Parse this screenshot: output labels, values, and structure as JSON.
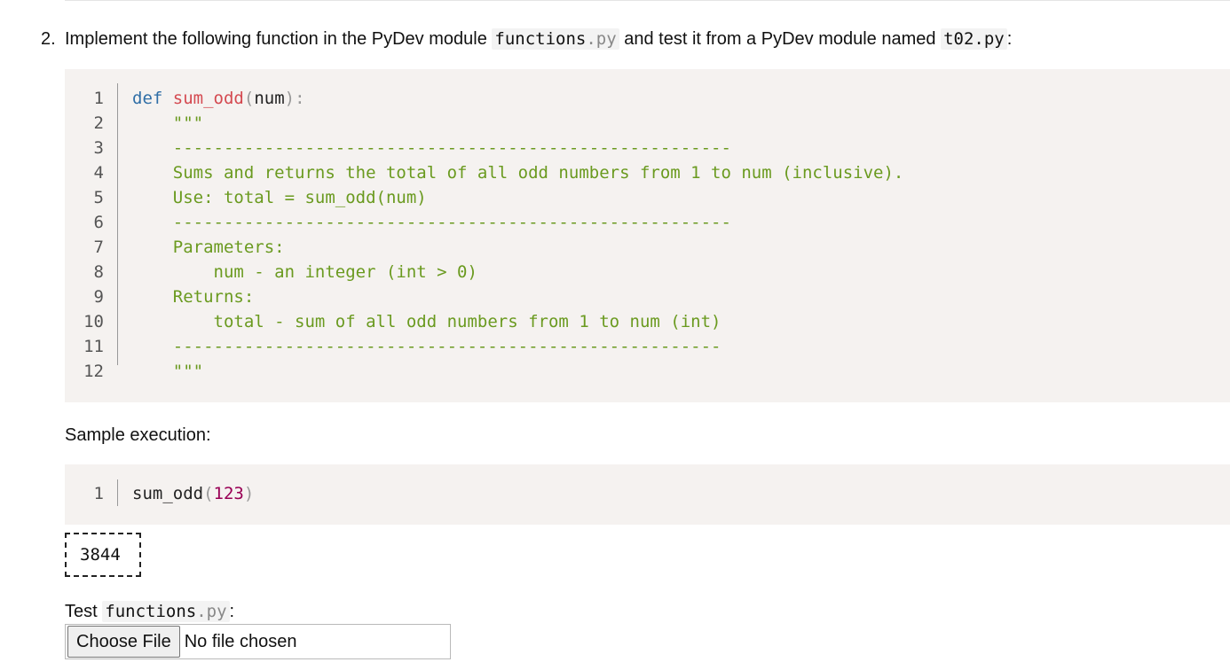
{
  "question": {
    "number": "2.",
    "text_before": "Implement the following function in the PyDev module",
    "module_name": "functions",
    "module_ext": ".py",
    "text_middle": "and test it from a PyDev module named",
    "test_module": "t02.py",
    "text_after": ":"
  },
  "code_block": {
    "lines": [
      {
        "n": "1",
        "tokens": [
          {
            "t": "def",
            "c": "kw"
          },
          {
            "t": " ",
            "c": "plain"
          },
          {
            "t": "sum_odd",
            "c": "fn"
          },
          {
            "t": "(",
            "c": "punc"
          },
          {
            "t": "num",
            "c": "param"
          },
          {
            "t": "):",
            "c": "punc"
          }
        ]
      },
      {
        "n": "2",
        "tokens": [
          {
            "t": "    \"\"\"",
            "c": "doc"
          }
        ]
      },
      {
        "n": "3",
        "tokens": [
          {
            "t": "    -------------------------------------------------------",
            "c": "doc"
          }
        ]
      },
      {
        "n": "4",
        "tokens": [
          {
            "t": "    Sums and returns the total of all odd numbers from 1 to num (inclusive).",
            "c": "doc"
          }
        ]
      },
      {
        "n": "5",
        "tokens": [
          {
            "t": "    Use: total = sum_odd(num)",
            "c": "doc"
          }
        ]
      },
      {
        "n": "6",
        "tokens": [
          {
            "t": "    -------------------------------------------------------",
            "c": "doc"
          }
        ]
      },
      {
        "n": "7",
        "tokens": [
          {
            "t": "    Parameters:",
            "c": "doc"
          }
        ]
      },
      {
        "n": "8",
        "tokens": [
          {
            "t": "        num - an integer (int > 0)",
            "c": "doc"
          }
        ]
      },
      {
        "n": "9",
        "tokens": [
          {
            "t": "    Returns:",
            "c": "doc"
          }
        ]
      },
      {
        "n": "10",
        "tokens": [
          {
            "t": "        total - sum of all odd numbers from 1 to num (int)",
            "c": "doc"
          }
        ]
      },
      {
        "n": "11",
        "tokens": [
          {
            "t": "    ------------------------------------------------------",
            "c": "doc"
          }
        ]
      },
      {
        "n": "12",
        "tokens": [
          {
            "t": "    \"\"\"",
            "c": "doc"
          }
        ]
      }
    ]
  },
  "sample": {
    "label": "Sample execution:",
    "lines": [
      {
        "n": "1",
        "tokens": [
          {
            "t": "sum_odd",
            "c": "plain"
          },
          {
            "t": "(",
            "c": "punc"
          },
          {
            "t": "123",
            "c": "num"
          },
          {
            "t": ")",
            "c": "punc"
          }
        ]
      }
    ],
    "output": "3844"
  },
  "test": {
    "label_prefix": "Test",
    "module_name": "functions",
    "module_ext": ".py",
    "label_suffix": ":",
    "button_label": "Choose File",
    "status": "No file chosen"
  }
}
